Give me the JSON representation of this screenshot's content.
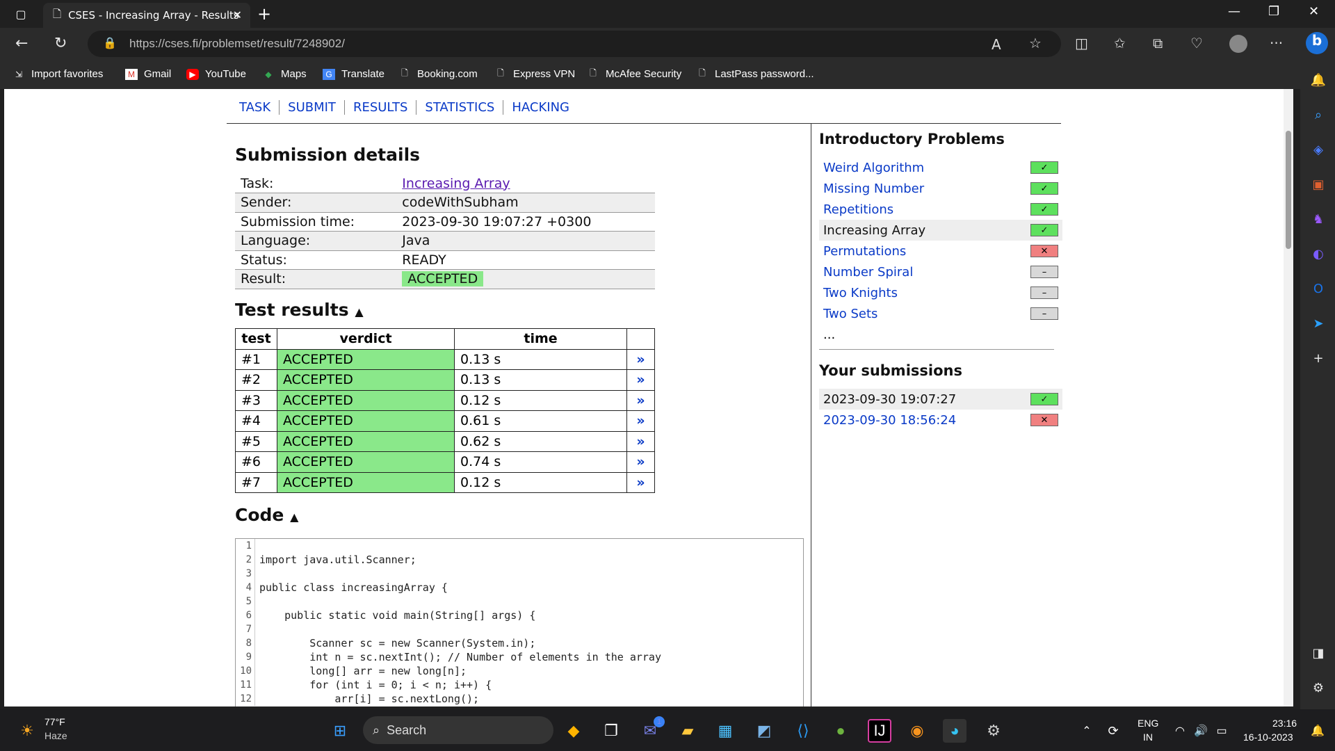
{
  "browser": {
    "tab_title": "CSES - Increasing Array - Results",
    "url": "https://cses.fi/problemset/result/7248902/"
  },
  "favorites": [
    "Import favorites",
    "Gmail",
    "YouTube",
    "Maps",
    "Translate",
    "Booking.com",
    "Express VPN",
    "McAfee Security",
    "LastPass password..."
  ],
  "nav": {
    "task": "TASK",
    "submit": "SUBMIT",
    "results": "RESULTS",
    "statistics": "STATISTICS",
    "hacking": "HACKING"
  },
  "submission": {
    "title": "Submission details",
    "rows": [
      {
        "label": "Task:",
        "value": "Increasing Array"
      },
      {
        "label": "Sender:",
        "value": "codeWithSubham"
      },
      {
        "label": "Submission time:",
        "value": "2023-09-30 19:07:27 +0300"
      },
      {
        "label": "Language:",
        "value": "Java"
      },
      {
        "label": "Status:",
        "value": "READY"
      },
      {
        "label": "Result:",
        "value": "ACCEPTED"
      }
    ]
  },
  "tests": {
    "title": "Test results",
    "headers": [
      "test",
      "verdict",
      "time"
    ],
    "rows": [
      {
        "test": "#1",
        "verdict": "ACCEPTED",
        "time": "0.13 s"
      },
      {
        "test": "#2",
        "verdict": "ACCEPTED",
        "time": "0.13 s"
      },
      {
        "test": "#3",
        "verdict": "ACCEPTED",
        "time": "0.12 s"
      },
      {
        "test": "#4",
        "verdict": "ACCEPTED",
        "time": "0.61 s"
      },
      {
        "test": "#5",
        "verdict": "ACCEPTED",
        "time": "0.62 s"
      },
      {
        "test": "#6",
        "verdict": "ACCEPTED",
        "time": "0.74 s"
      },
      {
        "test": "#7",
        "verdict": "ACCEPTED",
        "time": "0.12 s"
      }
    ],
    "link_glyph": "»"
  },
  "code": {
    "title": "Code",
    "lines": [
      "",
      "import java.util.Scanner;",
      "",
      "public class increasingArray {",
      "",
      "    public static void main(String[] args) {",
      "",
      "        Scanner sc = new Scanner(System.in);",
      "        int n = sc.nextInt(); // Number of elements in the array",
      "        long[] arr = new long[n];",
      "        for (int i = 0; i < n; i++) {",
      "            arr[i] = sc.nextLong();"
    ]
  },
  "sidebar": {
    "problems_title": "Introductory Problems",
    "problems": [
      {
        "name": "Weird Algorithm",
        "status": "ok"
      },
      {
        "name": "Missing Number",
        "status": "ok"
      },
      {
        "name": "Repetitions",
        "status": "ok"
      },
      {
        "name": "Increasing Array",
        "status": "ok",
        "current": true
      },
      {
        "name": "Permutations",
        "status": "bad"
      },
      {
        "name": "Number Spiral",
        "status": "none"
      },
      {
        "name": "Two Knights",
        "status": "none"
      },
      {
        "name": "Two Sets",
        "status": "none"
      }
    ],
    "more": "...",
    "submissions_title": "Your submissions",
    "submissions": [
      {
        "time": "2023-09-30 19:07:27",
        "status": "ok",
        "current": true
      },
      {
        "time": "2023-09-30 18:56:24",
        "status": "bad"
      }
    ]
  },
  "taskbar": {
    "weather_temp": "77°F",
    "weather_desc": "Haze",
    "search": "Search",
    "lang1": "ENG",
    "lang2": "IN",
    "time": "23:16",
    "date": "16-10-2023",
    "badge": "1"
  }
}
